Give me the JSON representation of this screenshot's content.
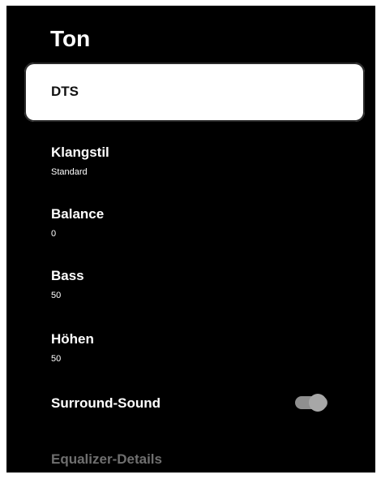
{
  "page": {
    "title": "Ton"
  },
  "highlighted_option": {
    "label": "DTS"
  },
  "settings": {
    "klangstil": {
      "label": "Klangstil",
      "value": "Standard"
    },
    "balance": {
      "label": "Balance",
      "value": "0"
    },
    "bass": {
      "label": "Bass",
      "value": "50"
    },
    "hoehen": {
      "label": "Höhen",
      "value": "50"
    },
    "surround": {
      "label": "Surround-Sound",
      "state": "on"
    },
    "equalizer": {
      "label": "Equalizer-Details"
    }
  },
  "colors": {
    "background": "#000000",
    "text": "#ffffff",
    "selected_background": "#ffffff",
    "selected_text": "#111111",
    "disabled_text": "#6f6f6f",
    "toggle_track": "#8f8f8f",
    "toggle_knob": "#a7a7a7"
  }
}
